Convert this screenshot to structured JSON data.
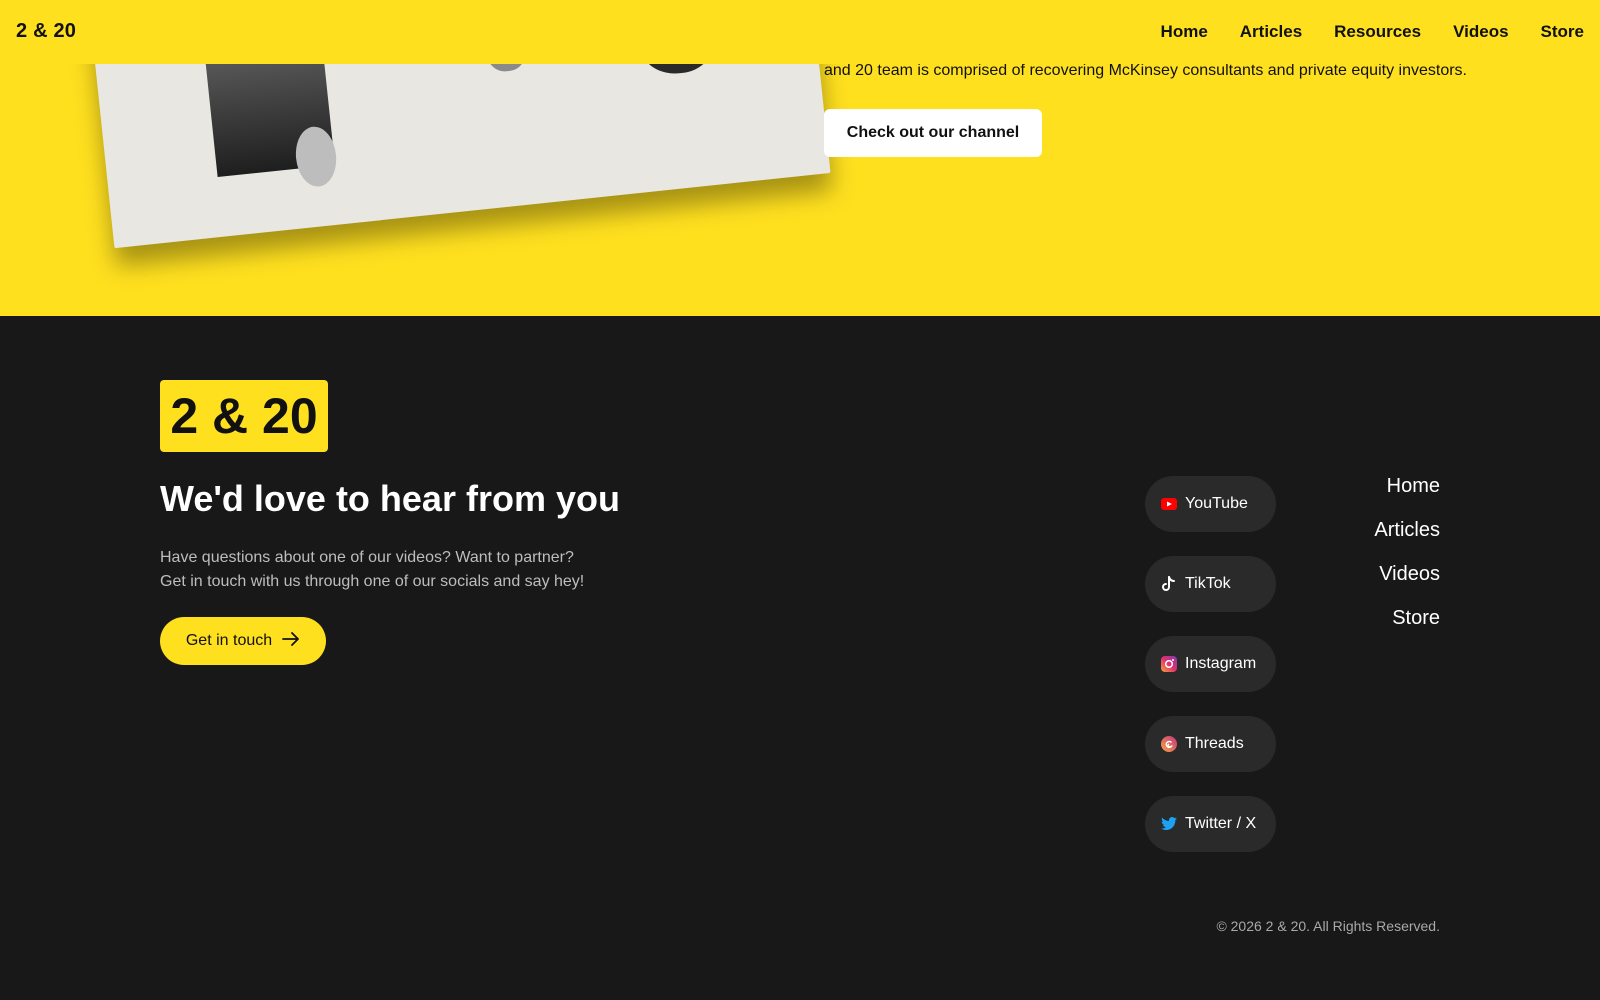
{
  "nav": {
    "brand": "2 & 20",
    "links": [
      "Home",
      "Articles",
      "Resources",
      "Videos",
      "Store"
    ]
  },
  "hero": {
    "text": "and 20 team is comprised of recovering McKinsey consultants and private equity investors.",
    "button_label": "Check out our channel",
    "image_icon": "world-map-collage-image"
  },
  "footer": {
    "logo": "2 & 20",
    "headline": "We'd love to hear from you",
    "desc_line1": "Have questions about one of our videos? Want to partner?",
    "desc_line2": "Get in touch with us through one of our socials and say hey!",
    "cta_label": "Get in touch",
    "socials": [
      {
        "label": "YouTube",
        "icon": "youtube-icon",
        "color": "#FF0000"
      },
      {
        "label": "TikTok",
        "icon": "tiktok-icon",
        "color": "#FFFFFF"
      },
      {
        "label": "Instagram",
        "icon": "instagram-icon",
        "color": "#E1306C"
      },
      {
        "label": "Threads",
        "icon": "threads-icon",
        "color": "#F56040"
      },
      {
        "label": "Twitter / X",
        "icon": "twitter-icon",
        "color": "#1DA1F2"
      }
    ],
    "nav": [
      "Home",
      "Articles",
      "Videos",
      "Store"
    ],
    "copyright": "© 2026 2 & 20. All Rights Reserved."
  },
  "colors": {
    "accent": "#FFE01F",
    "footer_bg": "#181818",
    "pill_bg": "#2A2A2A"
  }
}
